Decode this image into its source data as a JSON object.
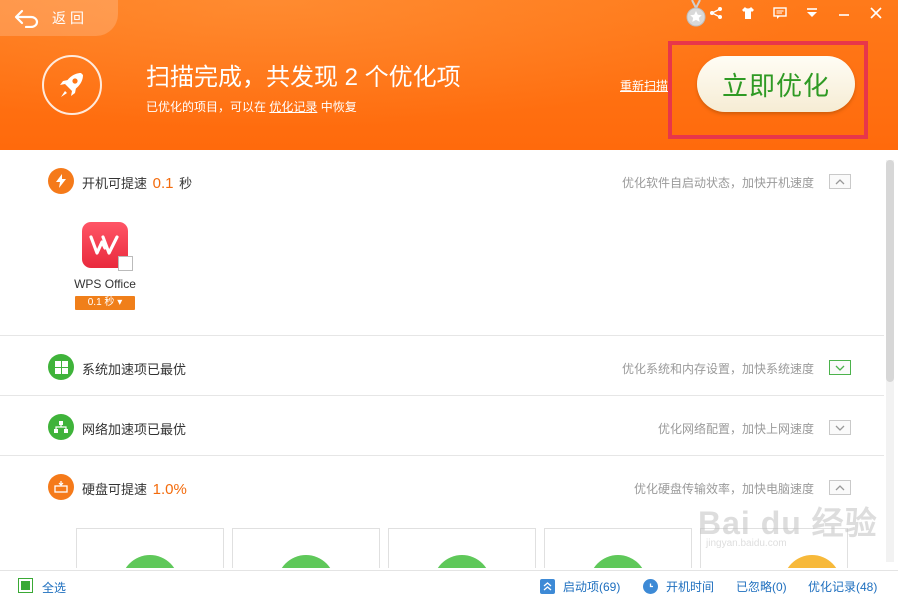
{
  "header": {
    "back_label": "返回",
    "title": "扫描完成，共发现 2 个优化项",
    "subtitle_prefix": "已优化的项目，可以在 ",
    "subtitle_link": "优化记录",
    "subtitle_suffix": " 中恢复",
    "rescan_label": "重新扫描",
    "optimize_button": "立即优化",
    "accent_color": "#ff6e10",
    "highlight_color": "#e8364a"
  },
  "sections": {
    "boot": {
      "label": "开机可提速",
      "value": "0.1",
      "unit": "秒",
      "description": "优化软件自启动状态，加快开机速度"
    },
    "system": {
      "label": "系统加速项已最优",
      "description": "优化系统和内存设置，加快系统速度"
    },
    "network": {
      "label": "网络加速项已最优",
      "description": "优化网络配置，加快上网速度"
    },
    "disk": {
      "label": "硬盘可提速",
      "value": "1.0%",
      "description": "优化硬盘传输效率，加快电脑速度"
    }
  },
  "boot_items": [
    {
      "name": "WPS Office",
      "badge": "0.1 秒"
    }
  ],
  "watermark": {
    "text": "Bai du 经验",
    "sub": "jingyan.baidu.com"
  },
  "footer": {
    "select_all": "全选",
    "startup_items": "启动项(69)",
    "boot_time": "开机时间",
    "ignored": "已忽略(0)",
    "history": "优化记录(48)"
  }
}
